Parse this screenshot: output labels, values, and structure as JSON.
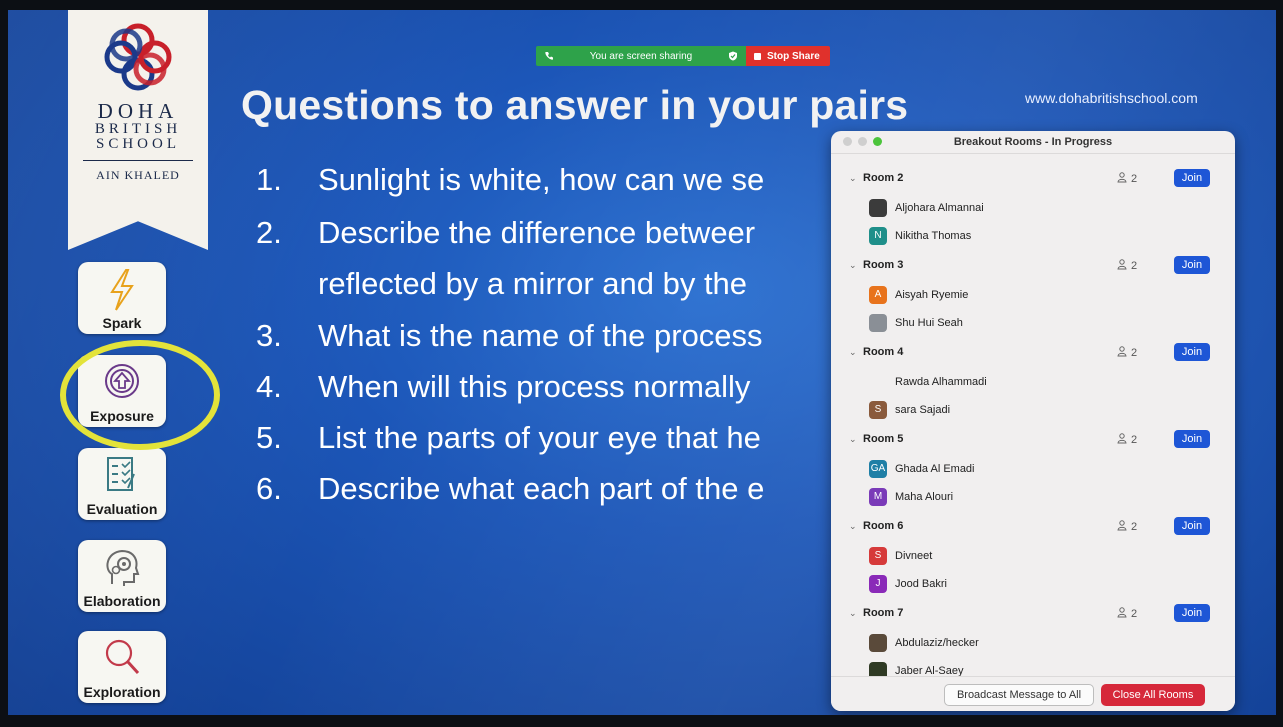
{
  "logo": {
    "line1": "DOHA",
    "line2": "BRITISH",
    "line3": "SCHOOL",
    "campus": "AIN KHALED"
  },
  "nav": [
    {
      "label": "Spark",
      "icon": "lightning-icon"
    },
    {
      "label": "Exposure",
      "icon": "arrow-up-circle-icon"
    },
    {
      "label": "Evaluation",
      "icon": "checklist-icon"
    },
    {
      "label": "Elaboration",
      "icon": "head-gears-icon"
    },
    {
      "label": "Exploration",
      "icon": "magnifier-icon"
    }
  ],
  "slide": {
    "title": "Questions to answer in your pairs",
    "url": "www.dohabritishschool.com",
    "questions": [
      {
        "num": "1.",
        "text": "Sunlight is white, how can we se"
      },
      {
        "num": "2.",
        "text": "Describe the difference betweer"
      },
      {
        "num": "",
        "text": "reflected by a mirror and by the"
      },
      {
        "num": "3.",
        "text": "What is the name of the process"
      },
      {
        "num": "4.",
        "text": "When will this process normally"
      },
      {
        "num": "5.",
        "text": "List the parts of your eye that he"
      },
      {
        "num": "6.",
        "text": "Describe what each part of the e"
      }
    ]
  },
  "share_bar": {
    "status": "You are screen sharing",
    "stop_label": "Stop Share",
    "status_color": "#2ea24a",
    "stop_color": "#e0312c"
  },
  "breakout": {
    "title": "Breakout Rooms - In Progress",
    "join_label": "Join",
    "rooms": [
      {
        "name": "Room 2",
        "count": "2",
        "members": [
          {
            "initial": "",
            "name": "Aljohara Almannai",
            "color": "#3b3b3b"
          },
          {
            "initial": "N",
            "name": "Nikitha Thomas",
            "color": "#1f8f8a"
          }
        ]
      },
      {
        "name": "Room 3",
        "count": "2",
        "members": [
          {
            "initial": "A",
            "name": "Aisyah Ryemie",
            "color": "#e8731c"
          },
          {
            "initial": "",
            "name": "Shu Hui Seah",
            "color": "#8a8f96"
          }
        ]
      },
      {
        "name": "Room 4",
        "count": "2",
        "members": [
          {
            "initial": "",
            "name": "Rawda Alhammadi",
            "color": "transparent"
          },
          {
            "initial": "S",
            "name": "sara Sajadi",
            "color": "#8a5a3c"
          }
        ]
      },
      {
        "name": "Room 5",
        "count": "2",
        "members": [
          {
            "initial": "GA",
            "name": "Ghada Al Emadi",
            "color": "#1f7fa6"
          },
          {
            "initial": "M",
            "name": "Maha Alouri",
            "color": "#7a3ab8"
          }
        ]
      },
      {
        "name": "Room 6",
        "count": "2",
        "members": [
          {
            "initial": "S",
            "name": "Divneet",
            "color": "#d63a3a"
          },
          {
            "initial": "J",
            "name": "Jood Bakri",
            "color": "#8a2ab8"
          }
        ]
      },
      {
        "name": "Room 7",
        "count": "2",
        "members": [
          {
            "initial": "",
            "name": "Abdulaziz/hecker",
            "color": "#5a4a3a"
          },
          {
            "initial": "",
            "name": "Jaber Al-Saey",
            "color": "#2f3a24"
          }
        ]
      }
    ],
    "broadcast_label": "Broadcast Message to All",
    "close_all_label": "Close All Rooms",
    "join_color": "#1e56d6",
    "close_color": "#d6283a"
  }
}
